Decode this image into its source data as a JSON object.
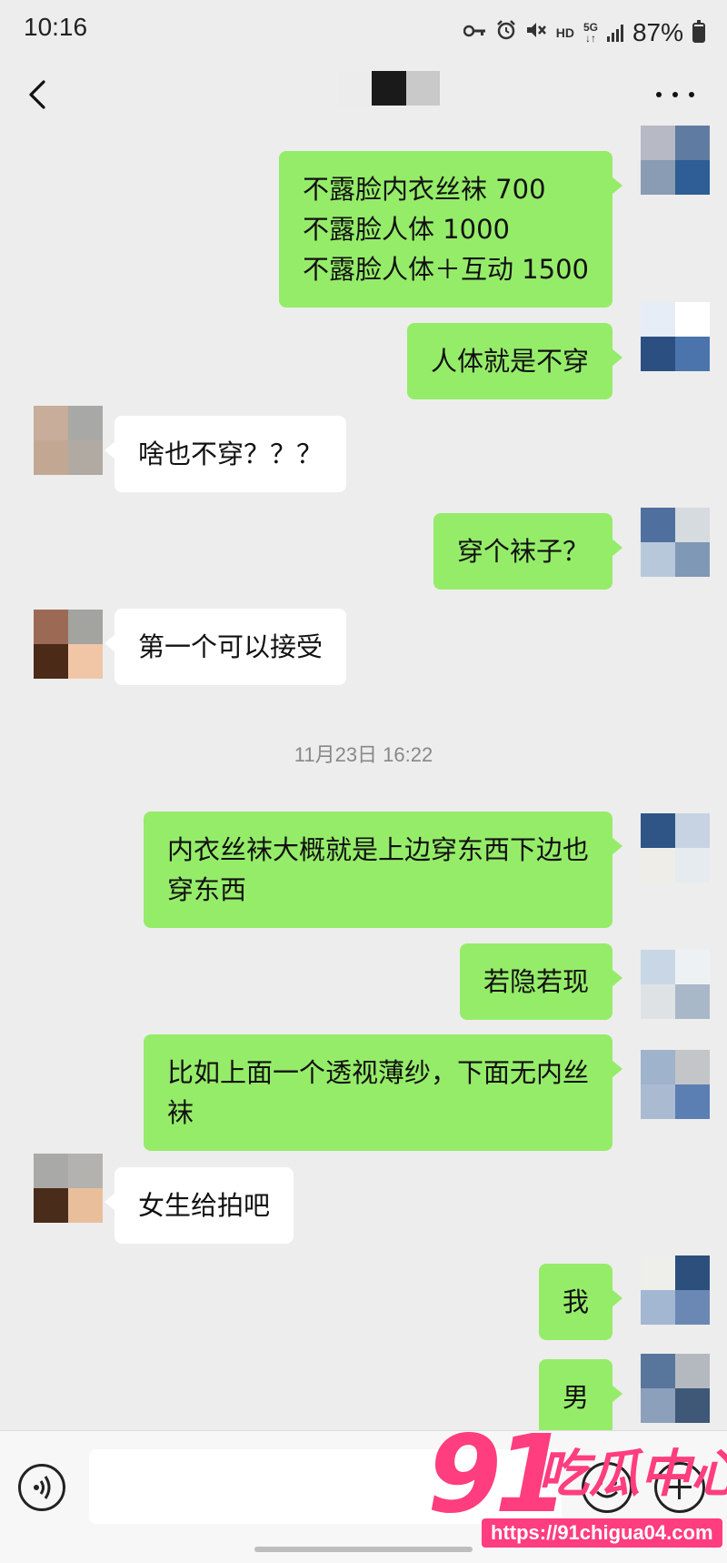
{
  "status_bar": {
    "time": "10:16",
    "hd_label": "HD",
    "network_label": "5G",
    "battery_percent": "87%",
    "battery_level": 0.87,
    "icons": [
      "key-icon",
      "alarm-icon",
      "mute-icon",
      "signal-icon",
      "battery-icon"
    ]
  },
  "header": {
    "back_icon": "chevron-left-icon",
    "more_icon": "more-dots-icon",
    "contact_name_blurred_colors": [
      "#ececec",
      "#1a1a1a",
      "#c9c9c9"
    ]
  },
  "conversation": {
    "messages": [
      {
        "side": "sent",
        "text": "不露脸内衣丝袜 700\n不露脸人体 1000\n不露脸人体＋互动 1500"
      },
      {
        "side": "sent",
        "text": "人体就是不穿"
      },
      {
        "side": "recv",
        "text": "啥也不穿？？？"
      },
      {
        "side": "sent",
        "text": "穿个袜子？"
      },
      {
        "side": "recv",
        "text": "第一个可以接受"
      },
      {
        "side": "sent",
        "text": "内衣丝袜大概就是上边穿东西下边也\n穿东西"
      },
      {
        "side": "sent",
        "text": "若隐若现"
      },
      {
        "side": "sent",
        "text": "比如上面一个透视薄纱，下面无内丝\n袜"
      },
      {
        "side": "recv",
        "text": "女生给拍吧"
      },
      {
        "side": "sent",
        "text": "我"
      },
      {
        "side": "sent",
        "text": "男"
      }
    ],
    "timestamp": "11月23日 16:22"
  },
  "input_bar": {
    "voice_icon": "voice-icon",
    "emoji_icon": "emoji-icon",
    "plus_icon": "plus-icon",
    "input_value": ""
  },
  "watermark": {
    "number": "91",
    "text": "吃瓜中心",
    "url": "https://91chigua04.com"
  },
  "colors": {
    "background": "#ededed",
    "sent_bubble": "#95ec69",
    "recv_bubble": "#ffffff",
    "watermark": "#ff3d7f"
  }
}
